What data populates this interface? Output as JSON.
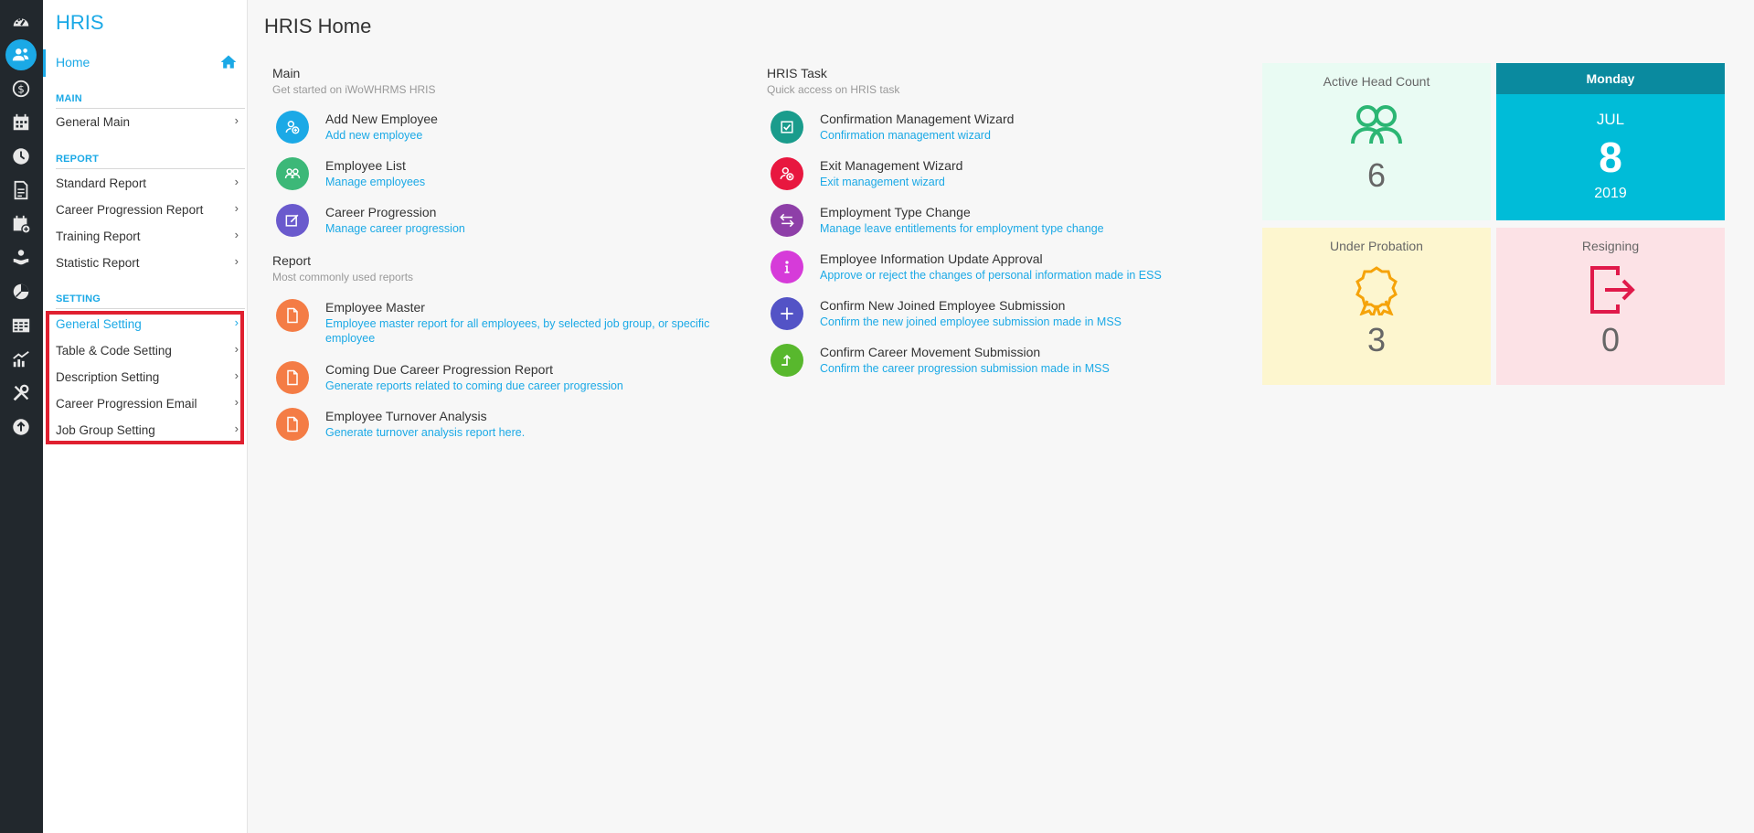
{
  "sidebar": {
    "app_title": "HRIS",
    "home_label": "Home",
    "sections": [
      {
        "title": "MAIN",
        "items": [
          {
            "label": "General Main"
          }
        ]
      },
      {
        "title": "REPORT",
        "items": [
          {
            "label": "Standard Report"
          },
          {
            "label": "Career Progression Report"
          },
          {
            "label": "Training Report"
          },
          {
            "label": "Statistic Report"
          }
        ]
      },
      {
        "title": "SETTING",
        "items": [
          {
            "label": "General Setting"
          },
          {
            "label": "Table & Code Setting"
          },
          {
            "label": "Description Setting"
          },
          {
            "label": "Career Progression Email"
          },
          {
            "label": "Job Group Setting"
          }
        ]
      }
    ],
    "chevron": "›"
  },
  "rail_icons": [
    "dashboard-icon",
    "people-icon",
    "dollar-icon",
    "calendar-grid-icon",
    "clock-icon",
    "document-icon",
    "calendar-add-icon",
    "hands-icon",
    "pie-chart-icon",
    "table-icon",
    "chart-icon",
    "tools-icon",
    "upload-icon"
  ],
  "page": {
    "title": "HRIS Home"
  },
  "main_group": {
    "title": "Main",
    "subtitle": "Get started on iWoWHRMS HRIS",
    "items": [
      {
        "title": "Add New Employee",
        "desc": "Add new employee",
        "color": "#1ba9e6",
        "icon": "add-user-icon"
      },
      {
        "title": "Employee List",
        "desc": "Manage employees",
        "color": "#3cb878",
        "icon": "users-icon"
      },
      {
        "title": "Career Progression",
        "desc": "Manage career progression",
        "color": "#6a5acd",
        "icon": "edit-icon"
      }
    ]
  },
  "report_group": {
    "title": "Report",
    "subtitle": "Most commonly used reports",
    "items": [
      {
        "title": "Employee Master",
        "desc": "Employee master report for all employees, by selected job group, or specific employee",
        "color": "#f47c45",
        "icon": "document-icon"
      },
      {
        "title": "Coming Due Career Progression Report",
        "desc": "Generate reports related to coming due career progression",
        "color": "#f47c45",
        "icon": "document-icon"
      },
      {
        "title": "Employee Turnover Analysis",
        "desc": "Generate turnover analysis report here.",
        "color": "#f47c45",
        "icon": "document-icon"
      }
    ]
  },
  "task_group": {
    "title": "HRIS Task",
    "subtitle": "Quick access on HRIS task",
    "items": [
      {
        "title": "Confirmation Management Wizard",
        "desc": "Confirmation management wizard",
        "color": "#1a9c8c",
        "icon": "check-square-icon"
      },
      {
        "title": "Exit Management Wizard",
        "desc": "Exit management wizard",
        "color": "#e8173f",
        "icon": "remove-user-icon"
      },
      {
        "title": "Employment Type Change",
        "desc": "Manage leave entitlements for employment type change",
        "color": "#8e3fa8",
        "icon": "swap-icon"
      },
      {
        "title": "Employee Information Update Approval",
        "desc": "Approve or reject the changes of personal information made in ESS",
        "color": "#d63bd9",
        "icon": "info-icon"
      },
      {
        "title": "Confirm New Joined Employee Submission",
        "desc": "Confirm the new joined employee submission made in MSS",
        "color": "#5353c6",
        "icon": "plus-icon"
      },
      {
        "title": "Confirm Career Movement Submission",
        "desc": "Confirm the career progression submission made in MSS",
        "color": "#58b82d",
        "icon": "step-up-icon"
      }
    ]
  },
  "cards": {
    "active_head_count": {
      "title": "Active Head Count",
      "value": "6",
      "bg": "#e9fbf3"
    },
    "date": {
      "day": "Monday",
      "month": "JUL",
      "date": "8",
      "year": "2019"
    },
    "under_probation": {
      "title": "Under Probation",
      "value": "3",
      "bg": "#fdf6cf"
    },
    "resigning": {
      "title": "Resigning",
      "value": "0",
      "bg": "#fce2e6"
    }
  },
  "colors": {
    "accent": "#1ba9e6",
    "rail": "#22282d",
    "highlight": "#e02030"
  }
}
